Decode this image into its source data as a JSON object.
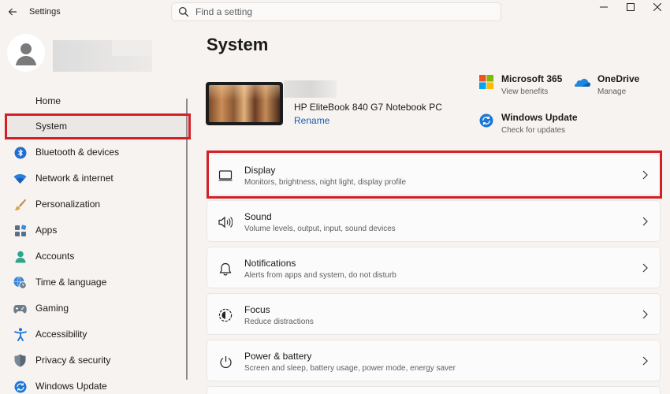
{
  "window": {
    "title": "Settings",
    "search_placeholder": "Find a setting"
  },
  "sidebar": {
    "items": [
      {
        "label": "Home",
        "icon": "home-icon"
      },
      {
        "label": "System",
        "icon": "system-icon"
      },
      {
        "label": "Bluetooth & devices",
        "icon": "bluetooth-icon"
      },
      {
        "label": "Network & internet",
        "icon": "wifi-icon"
      },
      {
        "label": "Personalization",
        "icon": "brush-icon"
      },
      {
        "label": "Apps",
        "icon": "apps-icon"
      },
      {
        "label": "Accounts",
        "icon": "person-icon"
      },
      {
        "label": "Time & language",
        "icon": "globe-clock-icon"
      },
      {
        "label": "Gaming",
        "icon": "gamepad-icon"
      },
      {
        "label": "Accessibility",
        "icon": "accessibility-icon"
      },
      {
        "label": "Privacy & security",
        "icon": "shield-icon"
      },
      {
        "label": "Windows Update",
        "icon": "update-icon"
      }
    ],
    "selected": "System"
  },
  "main": {
    "title": "System",
    "device": {
      "name": "HP EliteBook 840 G7 Notebook PC",
      "rename_label": "Rename"
    },
    "tiles": [
      {
        "title": "Microsoft 365",
        "subtitle": "View benefits",
        "icon": "microsoft-365-icon"
      },
      {
        "title": "OneDrive",
        "subtitle": "Manage",
        "icon": "onedrive-icon"
      },
      {
        "title": "Windows Update",
        "subtitle": "Check for updates",
        "icon": "windows-update-icon"
      }
    ],
    "cards": [
      {
        "title": "Display",
        "subtitle": "Monitors, brightness, night light, display profile",
        "icon": "display-icon"
      },
      {
        "title": "Sound",
        "subtitle": "Volume levels, output, input, sound devices",
        "icon": "speaker-icon"
      },
      {
        "title": "Notifications",
        "subtitle": "Alerts from apps and system, do not disturb",
        "icon": "bell-icon"
      },
      {
        "title": "Focus",
        "subtitle": "Reduce distractions",
        "icon": "focus-icon"
      },
      {
        "title": "Power & battery",
        "subtitle": "Screen and sleep, battery usage, power mode, energy saver",
        "icon": "power-icon"
      }
    ]
  },
  "colors": {
    "background": "#f6f3f1",
    "highlight": "#d32027",
    "link": "#1a5db4"
  }
}
